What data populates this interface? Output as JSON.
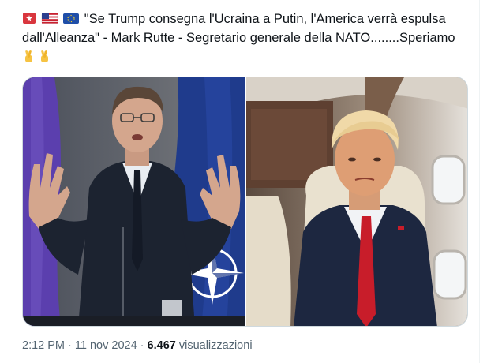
{
  "tweet": {
    "text_line1": "\"Se Trump consegna l'Ucraina a Putin, l'America verrà espulsa",
    "text_line2": "dall'Alleanza\" - Mark Rutte - Segretario generale della NATO........Speriamo",
    "emojis_leading": [
      "red-flag-emoji",
      "us-flag-emoji",
      "eu-flag-emoji"
    ],
    "emojis_trailing": [
      "crossed-fingers-emoji",
      "crossed-fingers-emoji"
    ]
  },
  "media": {
    "photos": [
      "photo-mark-rutte",
      "photo-donald-trump"
    ]
  },
  "meta": {
    "time": "2:12 PM",
    "separator1": " · ",
    "date": "11 nov 2024",
    "separator2": " · ",
    "view_count": "6.467",
    "views_label": " visualizzazioni"
  },
  "colors": {
    "text": "#0f1419",
    "secondary_text": "#536471",
    "border": "#cfd9de",
    "nato_blue": "#1f3b8c"
  }
}
